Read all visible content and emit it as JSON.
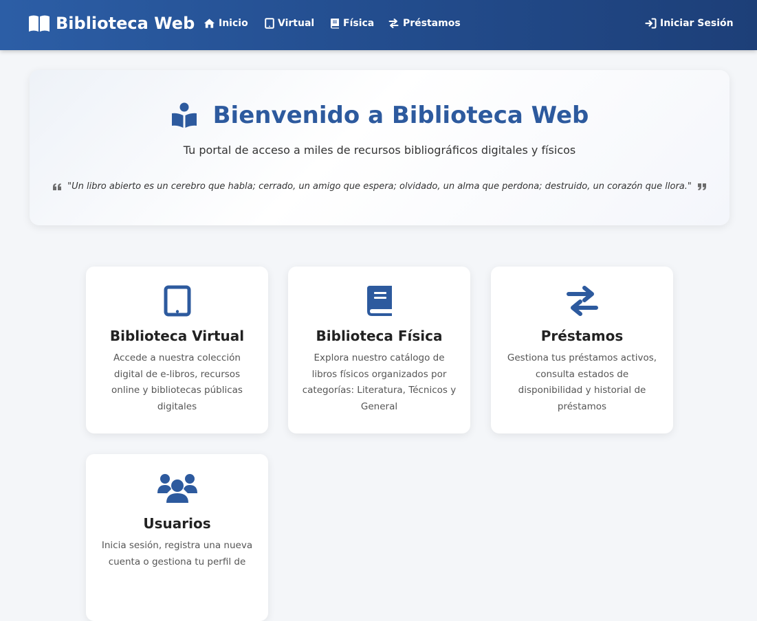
{
  "navbar": {
    "brand": "Biblioteca Web",
    "links": [
      {
        "label": "Inicio",
        "icon": "home-icon"
      },
      {
        "label": "Virtual",
        "icon": "tablet-icon"
      },
      {
        "label": "Física",
        "icon": "book-icon"
      },
      {
        "label": "Préstamos",
        "icon": "exchange-icon"
      }
    ],
    "login": {
      "label": "Iniciar Sesión",
      "icon": "sign-in-icon"
    }
  },
  "hero": {
    "title": "Bienvenido a Biblioteca Web",
    "subtitle": "Tu portal de acceso a miles de recursos bibliográficos digitales y físicos",
    "quote": "\"Un libro abierto es un cerebro que habla; cerrado, un amigo que espera; olvidado, un alma que perdona; destruido, un corazón que llora.\""
  },
  "cards": [
    {
      "title": "Biblioteca Virtual",
      "description": "Accede a nuestra colección digital de e-libros, recursos online y bibliotecas públicas digitales",
      "icon": "tablet-icon"
    },
    {
      "title": "Biblioteca Física",
      "description": "Explora nuestro catálogo de libros físicos organizados por categorías: Literatura, Técnicos y General",
      "icon": "book-icon"
    },
    {
      "title": "Préstamos",
      "description": "Gestiona tus préstamos activos, consulta estados de disponibilidad y historial de préstamos",
      "icon": "exchange-icon"
    },
    {
      "title": "Usuarios",
      "description": "Inicia sesión, registra una nueva cuenta o gestiona tu perfil de",
      "icon": "users-icon"
    }
  ],
  "colors": {
    "primary": "#2d5a9e",
    "navbar_start": "#2c5ea6",
    "navbar_end": "#1d3f78",
    "background": "#f4f6f9"
  }
}
